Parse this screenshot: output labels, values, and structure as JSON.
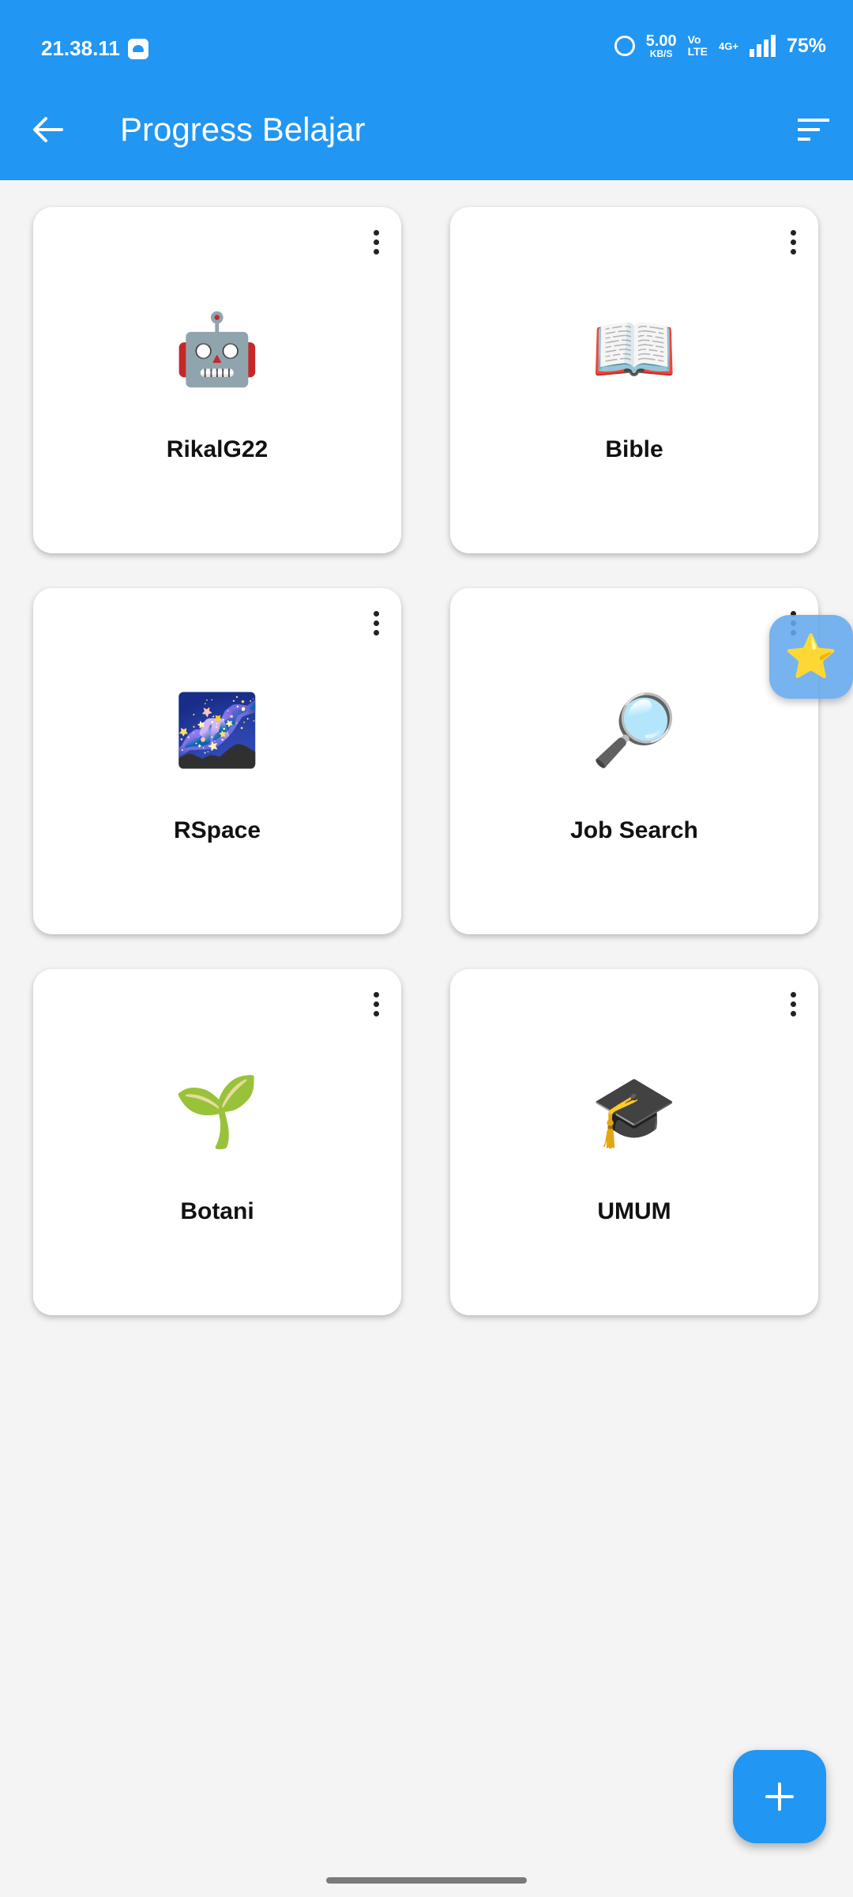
{
  "status_bar": {
    "time": "21.38.11",
    "net_speed_value": "5.00",
    "net_speed_unit": "KB/S",
    "volte_top": "Vo",
    "volte_bottom": "LTE",
    "network": "4G+",
    "battery": "75%"
  },
  "app_bar": {
    "title": "Progress Belajar",
    "back_icon": "arrow-left-icon",
    "sort_icon": "sort-icon"
  },
  "cards": [
    {
      "emoji": "🤖",
      "label": "RikalG22"
    },
    {
      "emoji": "📖",
      "label": "Bible"
    },
    {
      "emoji": "🌌",
      "label": "RSpace"
    },
    {
      "emoji": "🔎",
      "label": "Job Search"
    },
    {
      "emoji": "🌱",
      "label": "Botani"
    },
    {
      "emoji": "🎓",
      "label": "UMUM"
    }
  ],
  "floating_favorite": {
    "emoji": "⭐"
  },
  "fab": {
    "icon": "plus-icon"
  },
  "colors": {
    "primary": "#2196f3",
    "background": "#f4f4f4",
    "card": "#ffffff"
  }
}
